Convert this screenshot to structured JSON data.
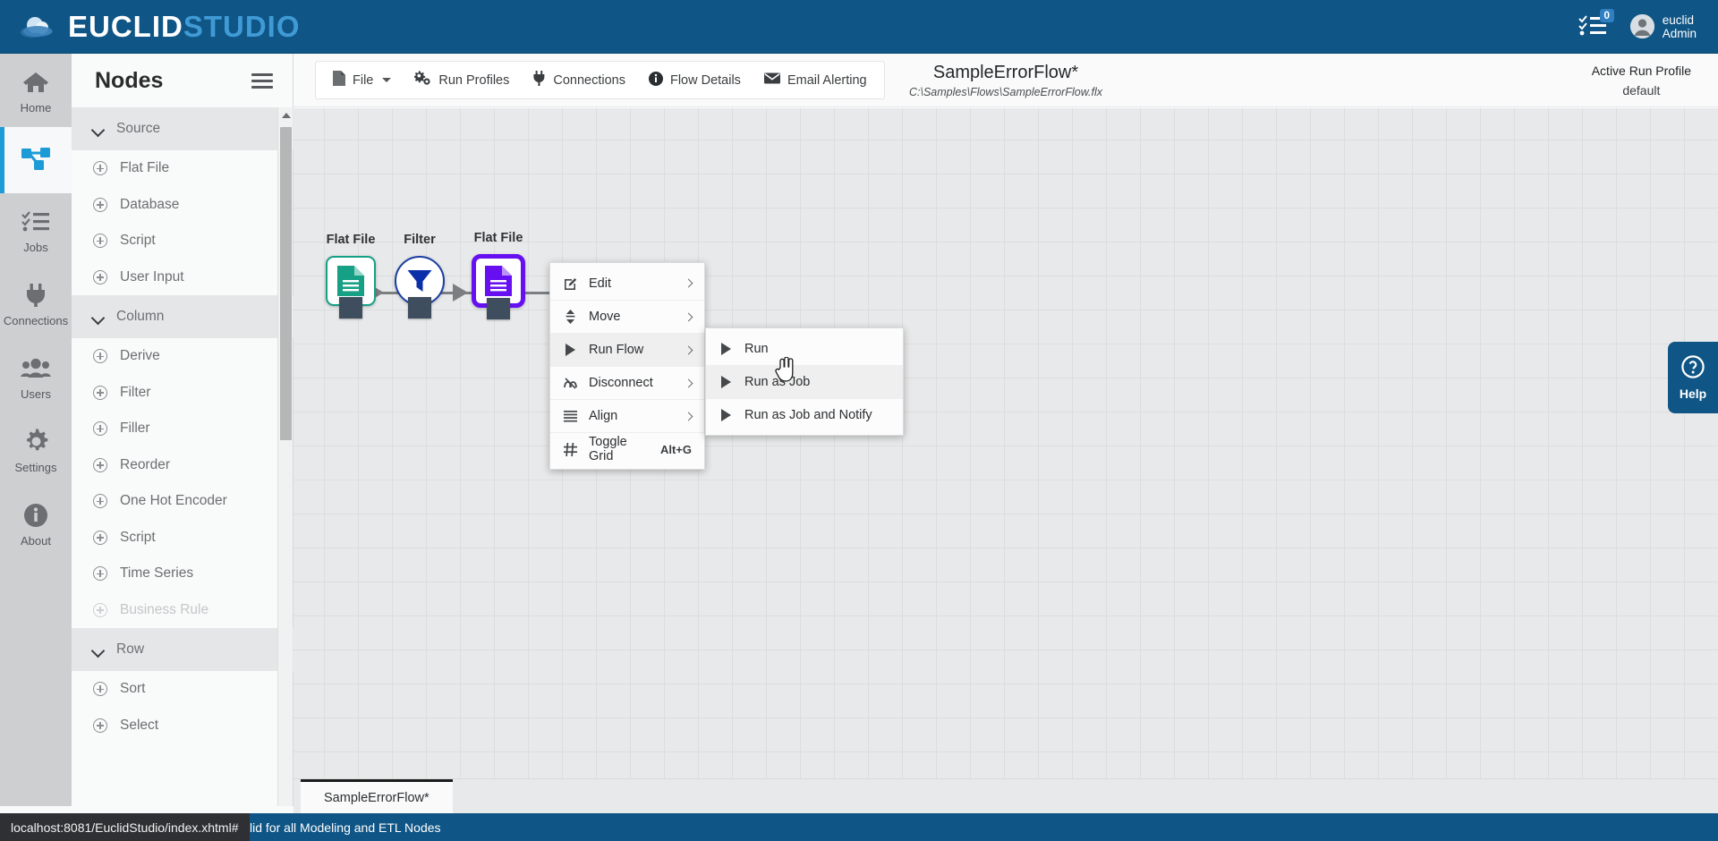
{
  "app": {
    "brand_primary": "EUCLID",
    "brand_secondary": "STUDIO",
    "header_color": "#0f5585",
    "accent_color": "#1d9bd7"
  },
  "header": {
    "tasks_icon": "tasks-checklist-icon",
    "tasks_badge": "0",
    "avatar_icon": "user-avatar-icon",
    "user_line1": "euclid",
    "user_line2": "Admin"
  },
  "rail": {
    "items": [
      {
        "label": "Home",
        "icon": "home-icon",
        "active": false
      },
      {
        "label": "",
        "icon": "flow-nodes-icon",
        "active": true
      },
      {
        "label": "Jobs",
        "icon": "jobs-checklist-icon",
        "active": false
      },
      {
        "label": "Connections",
        "icon": "plug-icon",
        "active": false
      },
      {
        "label": "Users",
        "icon": "users-group-icon",
        "active": false
      },
      {
        "label": "Settings",
        "icon": "gear-icon",
        "active": false
      },
      {
        "label": "About",
        "icon": "info-circle-icon",
        "active": false
      }
    ]
  },
  "nodes_panel": {
    "title": "Nodes",
    "menu_icon": "hamburger-icon",
    "groups": [
      {
        "label": "Source",
        "items": [
          {
            "label": "Flat File",
            "disabled": false
          },
          {
            "label": "Database",
            "disabled": false
          },
          {
            "label": "Script",
            "disabled": false
          },
          {
            "label": "User Input",
            "disabled": false
          }
        ]
      },
      {
        "label": "Column",
        "items": [
          {
            "label": "Derive",
            "disabled": false
          },
          {
            "label": "Filter",
            "disabled": false
          },
          {
            "label": "Filler",
            "disabled": false
          },
          {
            "label": "Reorder",
            "disabled": false
          },
          {
            "label": "One Hot Encoder",
            "disabled": false
          },
          {
            "label": "Script",
            "disabled": false
          },
          {
            "label": "Time Series",
            "disabled": false
          },
          {
            "label": "Business Rule",
            "disabled": true
          }
        ]
      },
      {
        "label": "Row",
        "items": [
          {
            "label": "Sort",
            "disabled": false
          },
          {
            "label": "Select",
            "disabled": false
          }
        ]
      }
    ]
  },
  "toolbar": {
    "buttons": [
      {
        "label": "File",
        "icon": "file-icon",
        "has_caret": true
      },
      {
        "label": "Run Profiles",
        "icon": "gears-icon",
        "has_caret": false
      },
      {
        "label": "Connections",
        "icon": "plug-icon",
        "has_caret": false
      },
      {
        "label": "Flow Details",
        "icon": "info-circle-icon",
        "has_caret": false
      },
      {
        "label": "Email Alerting",
        "icon": "envelope-icon",
        "has_caret": false
      }
    ]
  },
  "flow": {
    "title": "SampleErrorFlow*",
    "path": "C:\\Samples\\Flows\\SampleErrorFlow.flx",
    "run_profile_label": "Active Run Profile",
    "run_profile_value": "default",
    "nodes": [
      {
        "label": "Flat File",
        "type": "flatfile",
        "color": "#16a085",
        "shape": "box"
      },
      {
        "label": "Filter",
        "type": "filter",
        "color": "#1b3fa0",
        "shape": "circle"
      },
      {
        "label": "Flat File",
        "type": "flatfile",
        "color": "#6610f2",
        "shape": "box",
        "selected": true
      }
    ]
  },
  "context_menu": {
    "items": [
      {
        "label": "Edit",
        "icon": "edit-pencil-icon",
        "submenu": true,
        "shortcut": "",
        "highlighted": false
      },
      {
        "label": "Move",
        "icon": "move-arrows-icon",
        "submenu": true,
        "shortcut": "",
        "highlighted": false
      },
      {
        "label": "Run Flow",
        "icon": "play-icon",
        "submenu": true,
        "shortcut": "",
        "highlighted": true
      },
      {
        "label": "Disconnect",
        "icon": "disconnect-icon",
        "submenu": true,
        "shortcut": "",
        "highlighted": false
      },
      {
        "label": "Align",
        "icon": "align-lines-icon",
        "submenu": true,
        "shortcut": "",
        "highlighted": false
      },
      {
        "label": "Toggle Grid",
        "icon": "hash-grid-icon",
        "submenu": false,
        "shortcut": "Alt+G",
        "highlighted": false
      }
    ]
  },
  "run_flow_submenu": {
    "items": [
      {
        "label": "Run",
        "icon": "play-icon",
        "highlighted": false
      },
      {
        "label": "Run as Job",
        "icon": "play-icon",
        "highlighted": true
      },
      {
        "label": "Run as Job and Notify",
        "icon": "play-icon",
        "highlighted": false
      }
    ]
  },
  "help": {
    "label": "Help",
    "icon": "question-circle-icon"
  },
  "bottom": {
    "document_tab": "SampleErrorFlow*",
    "status_text": "ption valid for all Modeling and ETL Nodes",
    "url_tooltip": "localhost:8081/EuclidStudio/index.xhtml#"
  }
}
